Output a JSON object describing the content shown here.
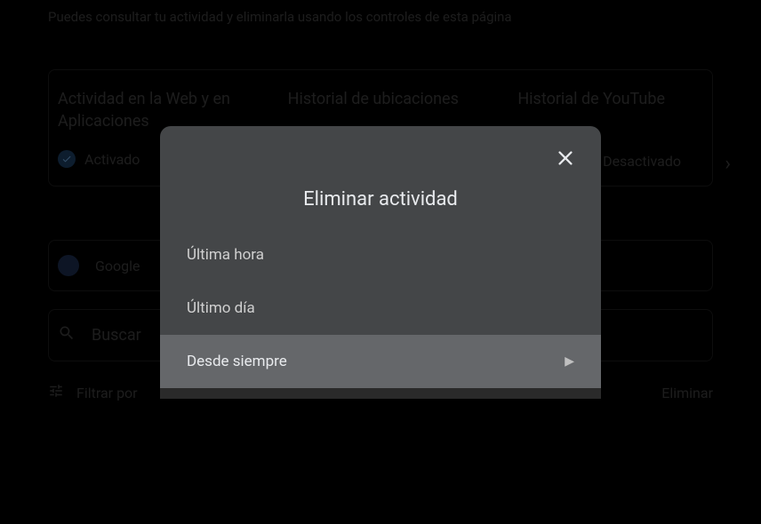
{
  "page": {
    "intro": "Puedes consultar tu actividad y eliminarla usando los controles de esta página"
  },
  "cards": {
    "web": "Actividad en la Web y en Aplicaciones",
    "location": "Historial de ubicaciones",
    "youtube": "Historial de YouTube",
    "activated": "Activado",
    "deactivated": "Desactivado"
  },
  "google_row": "Google",
  "search_placeholder": "Buscar",
  "filter_label": "Filtrar por",
  "delete_label": "Eliminar",
  "modal": {
    "title": "Eliminar actividad",
    "options": {
      "last_hour": "Última hora",
      "last_day": "Último día",
      "always": "Desde siempre"
    }
  }
}
